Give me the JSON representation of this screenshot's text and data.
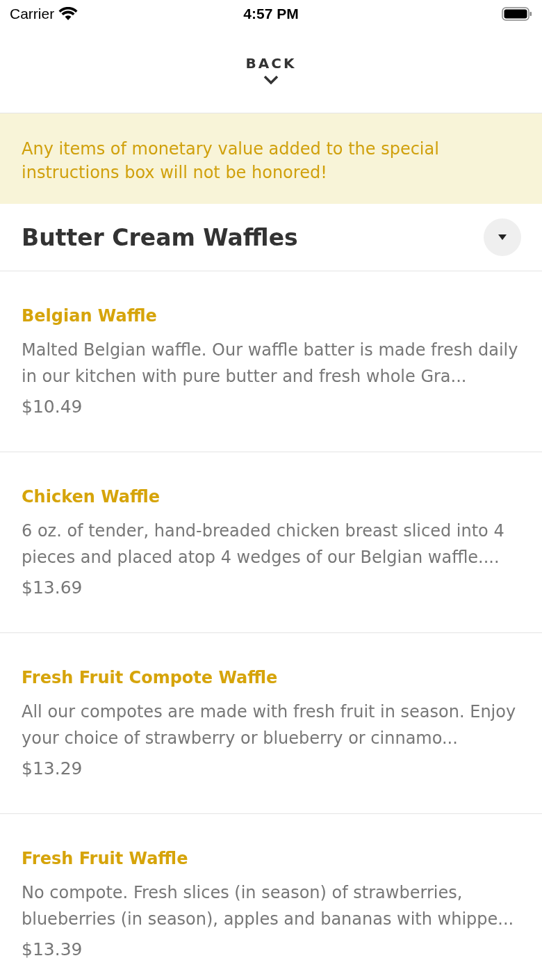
{
  "status_bar": {
    "carrier": "Carrier",
    "time": "4:57 PM"
  },
  "header": {
    "back_label": "BACK"
  },
  "notice": "Any items of monetary value added to the special instructions box will not be honored!",
  "section": {
    "title": "Butter Cream Waffles",
    "expanded": true
  },
  "items": [
    {
      "name": "Belgian Waffle",
      "description": "Malted Belgian waffle. Our waffle batter is made fresh daily in our kitchen with pure butter and fresh whole Gra...",
      "price": "$10.49"
    },
    {
      "name": "Chicken Waffle",
      "description": "6 oz. of tender, hand-breaded chicken breast sliced into 4 pieces and placed atop 4 wedges of our Belgian waffle....",
      "price": "$13.69"
    },
    {
      "name": "Fresh Fruit Compote Waffle",
      "description": "All our compotes are made with fresh fruit in season. Enjoy your choice of strawberry or blueberry or cinnamo...",
      "price": "$13.29"
    },
    {
      "name": "Fresh Fruit Waffle",
      "description": "No compote. Fresh slices (in season) of strawberries, blueberries (in season), apples and bananas with whippe...",
      "price": "$13.39"
    }
  ]
}
